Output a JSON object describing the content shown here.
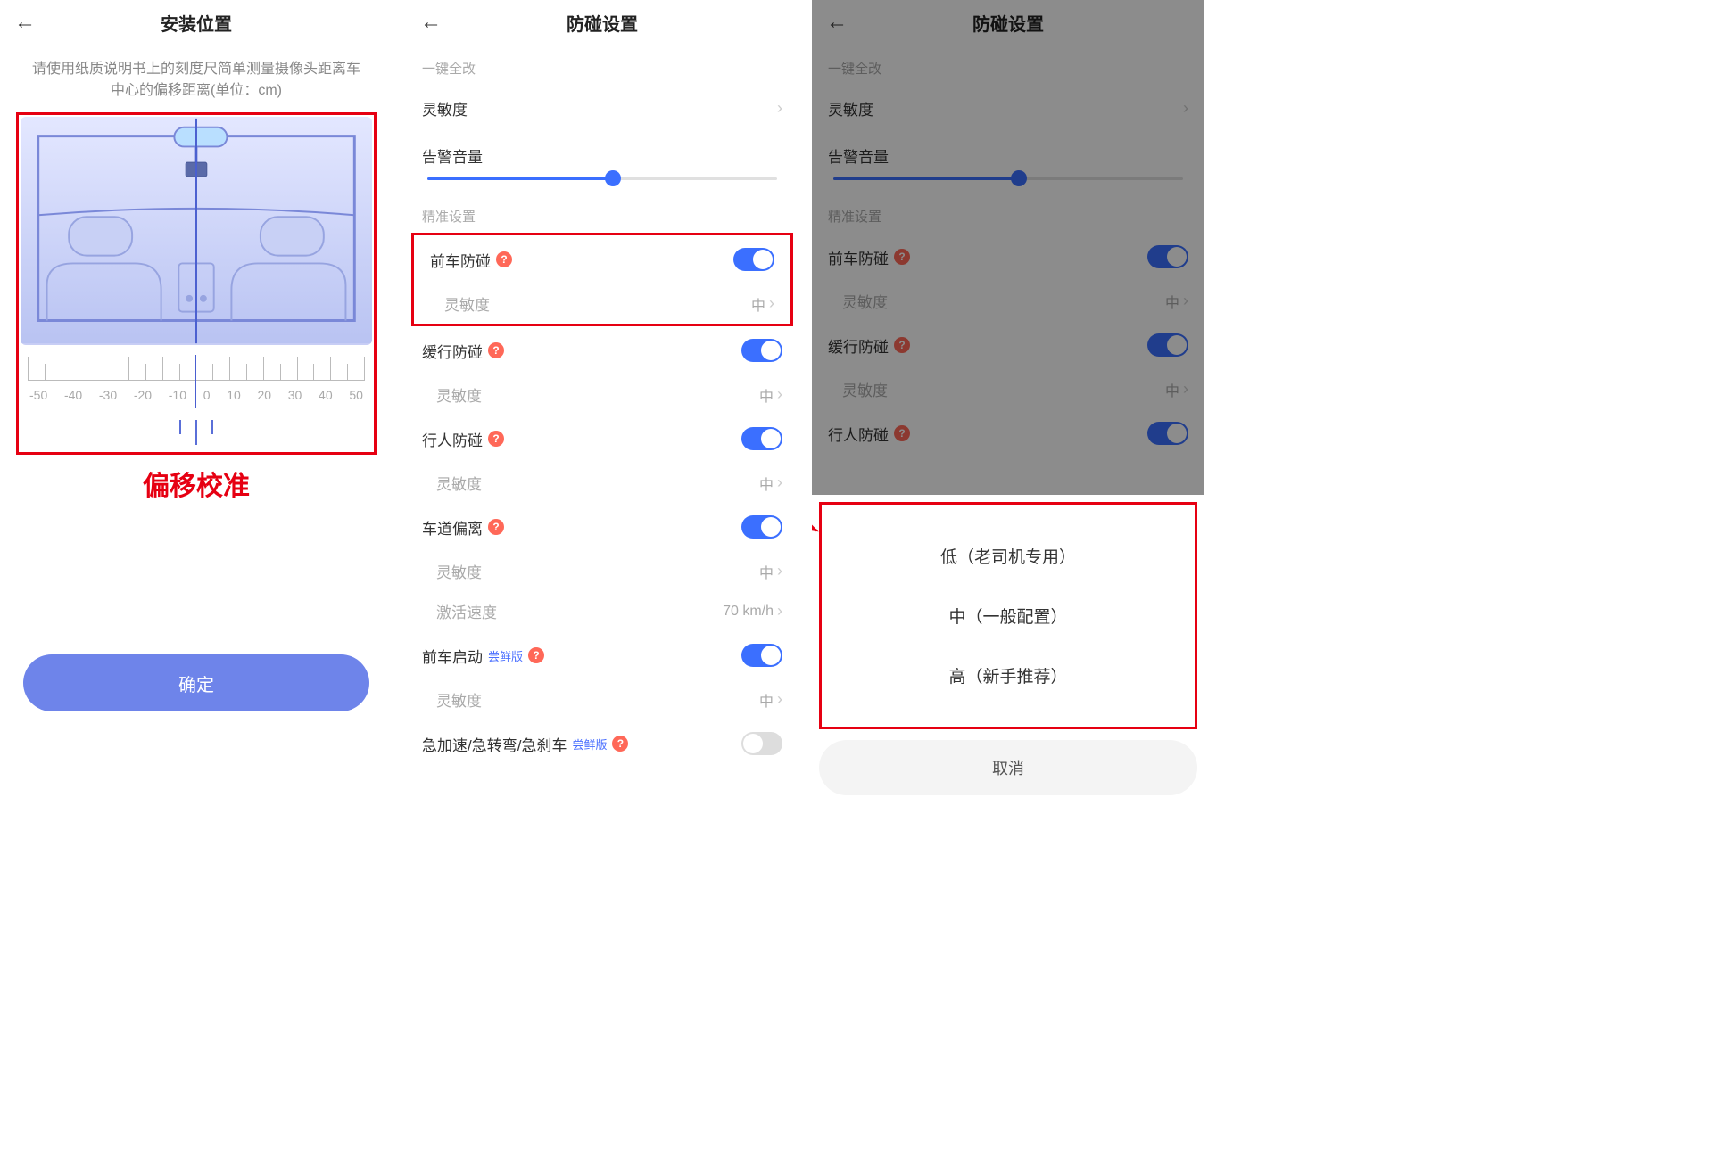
{
  "screen1": {
    "title": "安装位置",
    "instruction": "请使用纸质说明书上的刻度尺简单测量摄像头距离车中心的偏移距离(单位：cm)",
    "ruler_labels": [
      "-50",
      "-40",
      "-30",
      "-20",
      "-10",
      "0",
      "10",
      "20",
      "30",
      "40",
      "50"
    ],
    "red_annotation": "偏移校准",
    "confirm": "确定"
  },
  "screen2": {
    "title": "防碰设置",
    "section_quick": "一键全改",
    "sensitivity": "灵敏度",
    "volume_label": "告警音量",
    "section_precise": "精准设置",
    "items": {
      "front_collision": {
        "label": "前车防碰",
        "sens_label": "灵敏度",
        "sens_val": "中"
      },
      "slow_collision": {
        "label": "缓行防碰",
        "sens_label": "灵敏度",
        "sens_val": "中"
      },
      "pedestrian": {
        "label": "行人防碰",
        "sens_label": "灵敏度",
        "sens_val": "中"
      },
      "lane_departure": {
        "label": "车道偏离",
        "sens_label": "灵敏度",
        "sens_val": "中",
        "speed_label": "激活速度",
        "speed_val": "70 km/h"
      },
      "front_start": {
        "label": "前车启动",
        "beta": "尝鲜版",
        "sens_label": "灵敏度",
        "sens_val": "中"
      },
      "sudden": {
        "label": "急加速/急转弯/急刹车",
        "beta": "尝鲜版"
      }
    }
  },
  "screen3": {
    "title": "防碰设置",
    "section_quick": "一键全改",
    "sensitivity": "灵敏度",
    "volume_label": "告警音量",
    "section_precise": "精准设置",
    "items": {
      "front_collision": {
        "label": "前车防碰",
        "sens_label": "灵敏度",
        "sens_val": "中"
      },
      "slow_collision": {
        "label": "缓行防碰",
        "sens_label": "灵敏度",
        "sens_val": "中"
      },
      "pedestrian": {
        "label": "行人防碰"
      }
    },
    "sheet": {
      "opt_low": "低（老司机专用）",
      "opt_mid": "中（一般配置）",
      "opt_high": "高（新手推荐）",
      "cancel": "取消"
    }
  }
}
